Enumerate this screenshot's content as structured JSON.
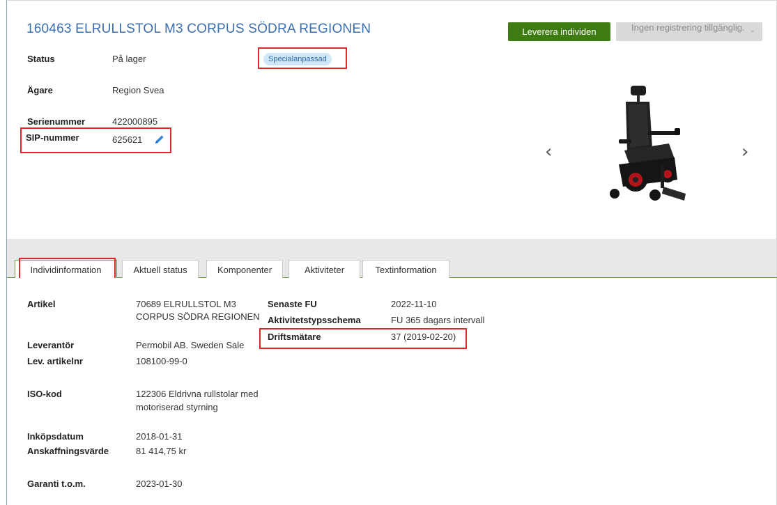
{
  "header": {
    "title": "160463 ELRULLSTOL M3 CORPUS SÖDRA REGIONEN",
    "deliver_button": "Leverera individen",
    "registration_select": "Ingen registrering tillgänglig."
  },
  "info": {
    "status_label": "Status",
    "status_value": "På lager",
    "badge": "Specialanpassad",
    "owner_label": "Ägare",
    "owner_value": "Region Svea",
    "serial_label": "Serienummer",
    "serial_value": "422000895",
    "sip_label": "SIP-nummer",
    "sip_value": "625621"
  },
  "carousel": {
    "prev": "‹",
    "next": "›"
  },
  "tabs": [
    {
      "label": "Individinformation",
      "active": true
    },
    {
      "label": "Aktuell status",
      "active": false
    },
    {
      "label": "Komponenter",
      "active": false
    },
    {
      "label": "Aktiviteter",
      "active": false
    },
    {
      "label": "Textinformation",
      "active": false
    }
  ],
  "details": {
    "artikel_label": "Artikel",
    "artikel_value_1": "70689 ELRULLSTOL M3",
    "artikel_value_2": "CORPUS SÖDRA REGIONEN",
    "leverantor_label": "Leverantör",
    "leverantor_value": "Permobil AB. Sweden Sale",
    "levart_label": "Lev. artikelnr",
    "levart_value": "108100-99-0",
    "iso_label": "ISO-kod",
    "iso_value_1": "122306 Eldrivna rullstolar med",
    "iso_value_2": "motoriserad styrning",
    "inkop_label": "Inköpsdatum",
    "inkop_value": "2018-01-31",
    "anskaff_label": "Anskaffningsvärde",
    "anskaff_value": "81 414,75 kr",
    "garanti_label": "Garanti t.o.m.",
    "garanti_value": "2023-01-30",
    "senaste_fu_label": "Senaste FU",
    "senaste_fu_value": "2022-11-10",
    "schema_label": "Aktivitetstypsschema",
    "schema_value": "FU 365 dagars intervall",
    "drift_label": "Driftsmätare",
    "drift_value": "37 (2019-02-20)"
  },
  "colors": {
    "title": "#3a6fb0",
    "deliver_button": "#3e7b13",
    "highlight": "#e0262a",
    "badge_bg": "#cfe7f7",
    "tab_accent": "#6b9c3a"
  }
}
